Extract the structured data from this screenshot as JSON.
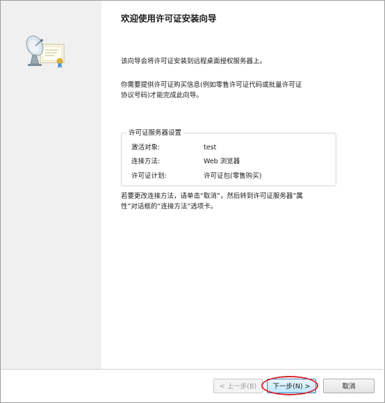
{
  "wizard": {
    "title": "欢迎使用许可证安装向导",
    "intro": "该向导会将许可证安装到远程桌面授权服务器上。",
    "info_line1": "你需要提供许可证购买信息(例如零售许可证代码或批量许可证",
    "info_line2": "协议号码)才能完成此向导。",
    "group_title": "许可证服务器设置",
    "settings": [
      {
        "label": "激活对象:",
        "value": "test"
      },
      {
        "label": "连接方法:",
        "value": "Web 浏览器"
      },
      {
        "label": "许可证计划:",
        "value": "许可证包(零售购买)"
      }
    ],
    "note_line1": "若要更改连接方法，请单击“取消”，然后转到许可证服务器”属",
    "note_line2": "性”对话框的“连接方法”选项卡。"
  },
  "buttons": {
    "back": "< 上一步(B)",
    "next": "下一步(N) >",
    "cancel": "取消"
  },
  "icons": {
    "wizard_icon": "satellite-certificate-icon"
  },
  "colors": {
    "highlight": "#d9232a",
    "primary_button_border": "#3c7fb1"
  }
}
